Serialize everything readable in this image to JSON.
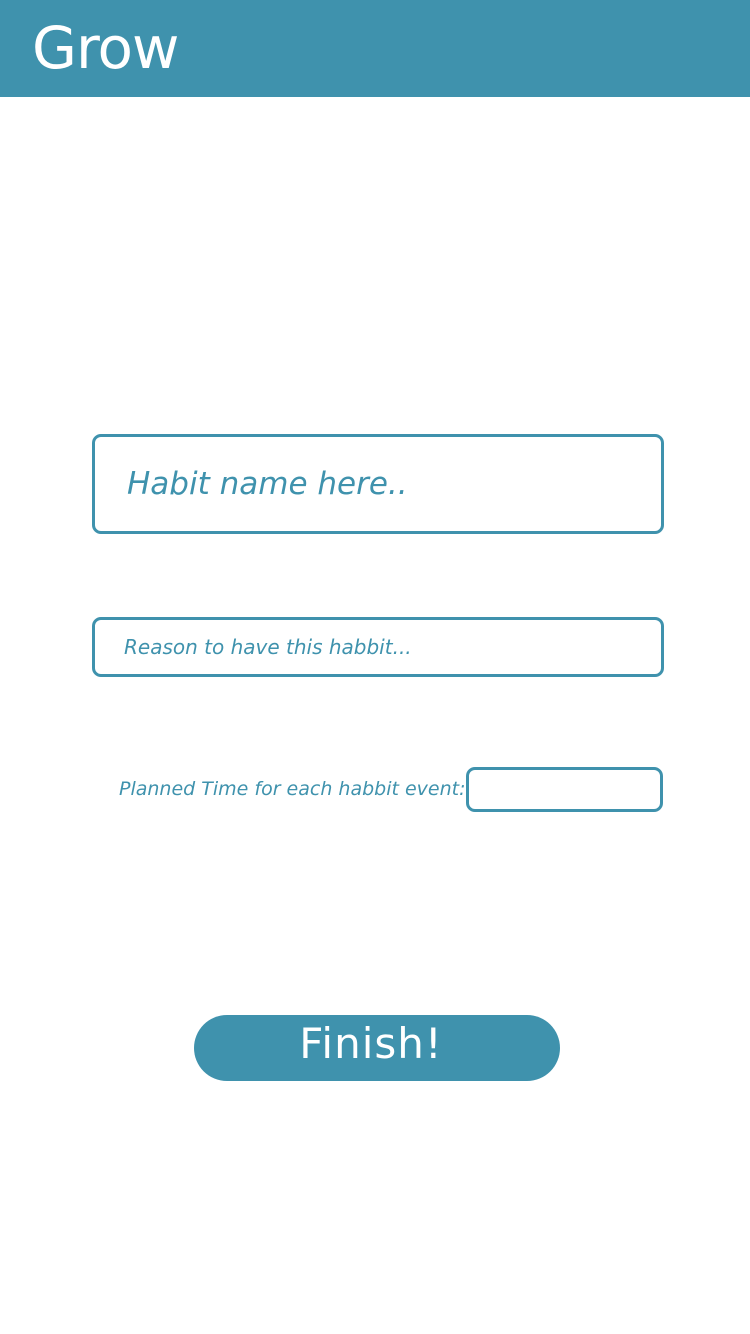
{
  "header": {
    "title": "Grow"
  },
  "form": {
    "habit_name_placeholder": "Habit name here..",
    "habit_name_value": "",
    "reason_placeholder": "Reason to have this habbit...",
    "reason_value": "",
    "planned_time_label": "Planned Time for each habbit event:",
    "planned_time_value": "",
    "finish_label": "Finish!"
  },
  "colors": {
    "accent": "#3f92ad",
    "background": "#ffffff",
    "on_accent": "#ffffff"
  }
}
